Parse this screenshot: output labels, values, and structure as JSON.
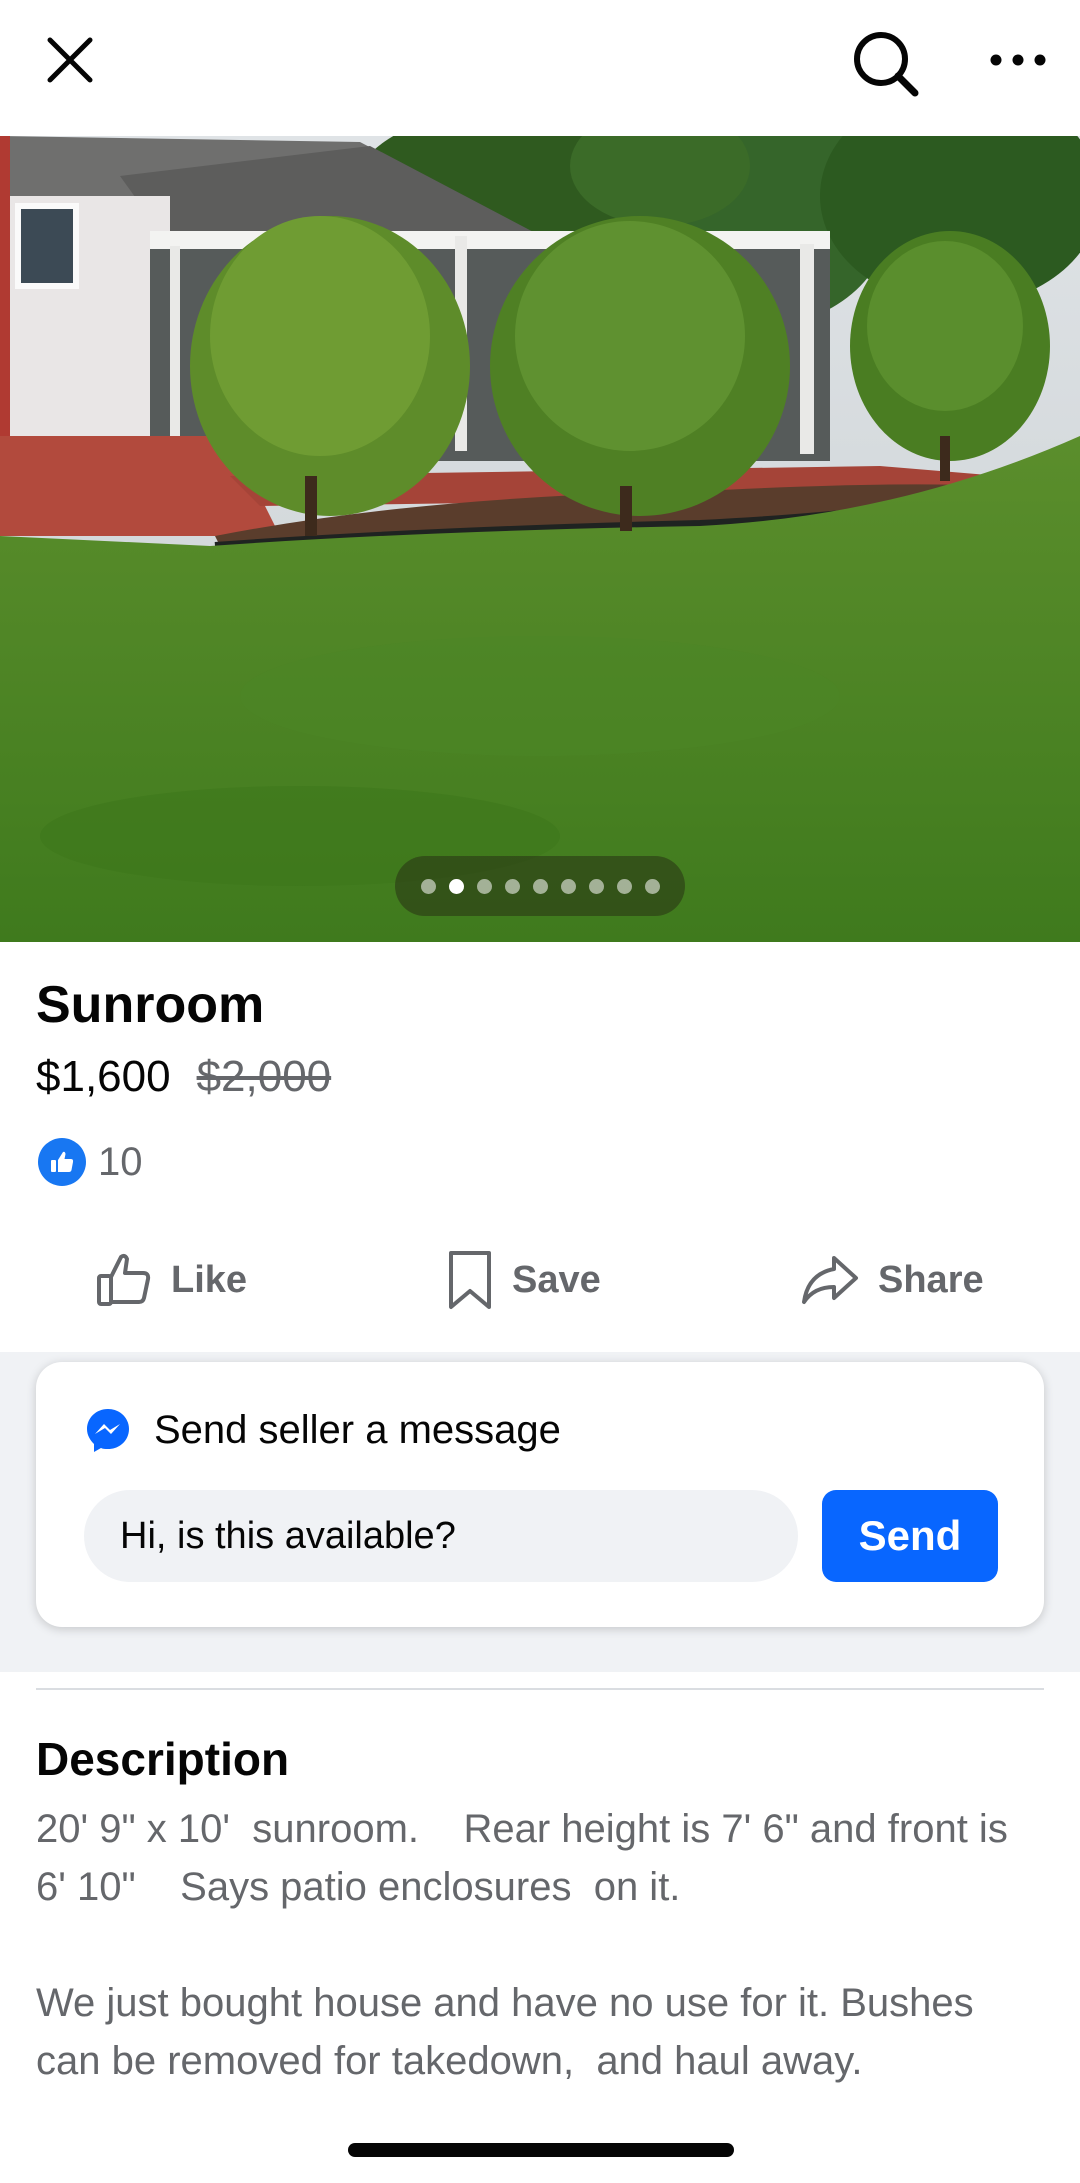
{
  "topbar": {
    "close_icon": "close-icon",
    "search_icon": "search-icon",
    "more_icon": "more-icon"
  },
  "gallery": {
    "photo_count": 9,
    "active_index": 1
  },
  "listing": {
    "title": "Sunroom",
    "price": "$1,600",
    "original_price": "$2,000",
    "like_count": "10"
  },
  "actions": {
    "like_label": "Like",
    "save_label": "Save",
    "share_label": "Share"
  },
  "message": {
    "heading": "Send seller a message",
    "input_value": "Hi, is this available?",
    "send_label": "Send"
  },
  "description": {
    "heading": "Description",
    "text": "20' 9\" x 10'  sunroom.    Rear height is 7' 6\" and front is 6' 10\"    Says patio enclosures  on it.\n\nWe just bought house and have no use for it. Bushes can be removed for takedown,  and haul away."
  },
  "colors": {
    "accent": "#0866ff",
    "like_badge": "#1877f2",
    "secondary_text": "#65676b"
  }
}
